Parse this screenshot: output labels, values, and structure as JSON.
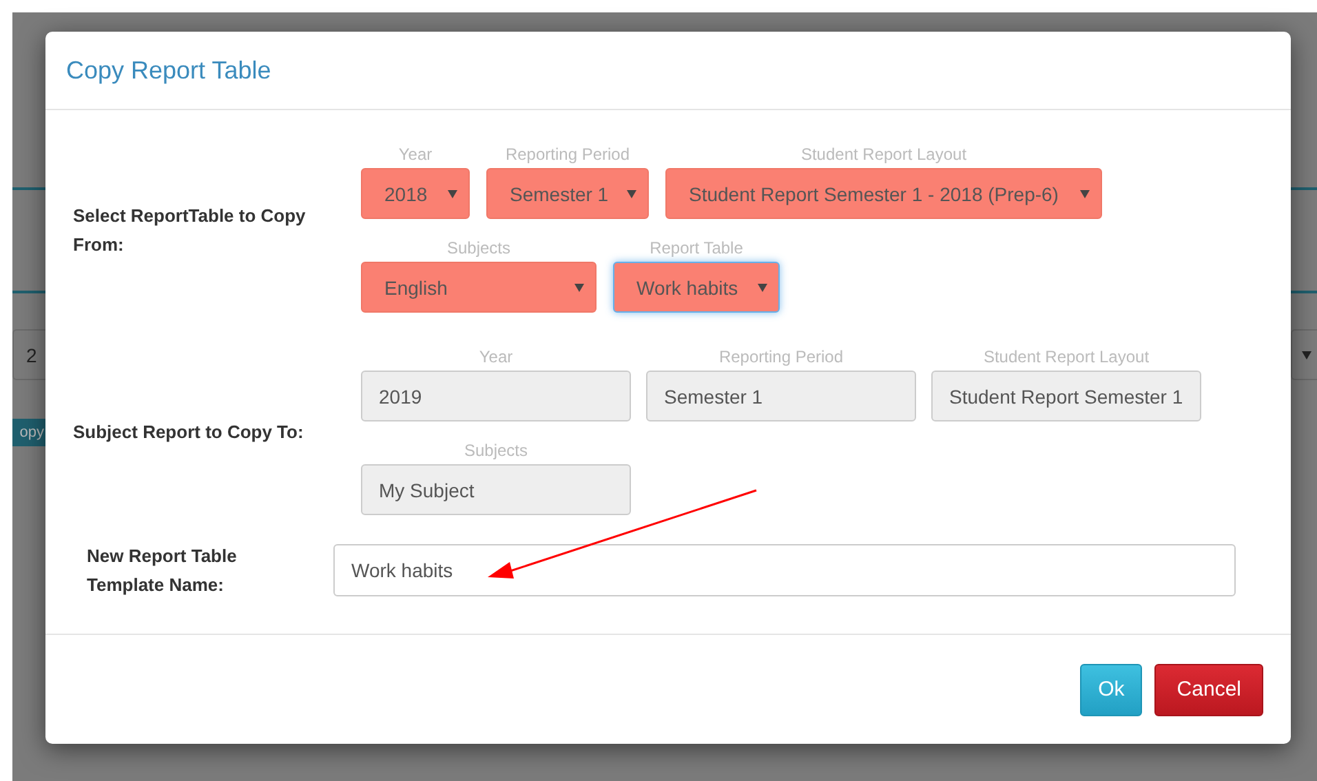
{
  "background": {
    "select_value": "2",
    "button": "opy"
  },
  "dialog": {
    "title": "Copy Report Table",
    "sections": [
      {
        "label": "Select ReportTable to Copy From:",
        "rows": [
          [
            {
              "kind": "select",
              "label": "Year",
              "value": "2018",
              "focused": false
            },
            {
              "kind": "select",
              "label": "Reporting Period",
              "value": "Semester 1",
              "focused": false
            },
            {
              "kind": "select",
              "label": "Student Report Layout",
              "value": "Student Report Semester 1 - 2018 (Prep-6)",
              "focused": false
            }
          ],
          [
            {
              "kind": "select",
              "label": "Subjects",
              "value": "English",
              "focused": false
            },
            {
              "kind": "select",
              "label": "Report Table",
              "value": "Work habits",
              "focused": true
            }
          ]
        ]
      },
      {
        "label": "Subject Report to Copy To:",
        "rows": [
          [
            {
              "kind": "readonly",
              "label": "Year",
              "value": "2019"
            },
            {
              "kind": "readonly",
              "label": "Reporting Period",
              "value": "Semester 1"
            },
            {
              "kind": "readonly",
              "label": "Student Report Layout",
              "value": "Student Report Semester 1"
            }
          ],
          [
            {
              "kind": "readonly",
              "label": "Subjects",
              "value": "My Subject"
            }
          ]
        ]
      }
    ],
    "name_field": {
      "label": "New Report Table Template Name:",
      "value": "Work habits"
    },
    "buttons": [
      {
        "kind": "primary",
        "label": "Ok"
      },
      {
        "kind": "danger",
        "label": "Cancel"
      }
    ]
  }
}
